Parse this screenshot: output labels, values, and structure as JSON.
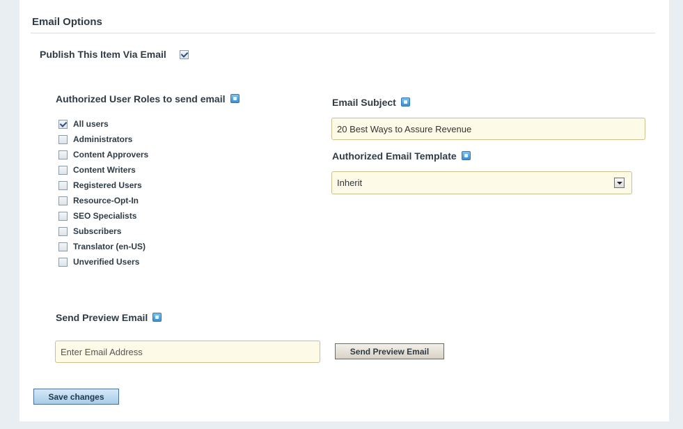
{
  "section": {
    "title": "Email Options"
  },
  "publish": {
    "label": "Publish This Item Via Email",
    "checked": true
  },
  "roles": {
    "heading": "Authorized User Roles to send email",
    "items": [
      {
        "label": "All users",
        "checked": true
      },
      {
        "label": "Administrators",
        "checked": false
      },
      {
        "label": "Content Approvers",
        "checked": false
      },
      {
        "label": "Content Writers",
        "checked": false
      },
      {
        "label": "Registered Users",
        "checked": false
      },
      {
        "label": "Resource-Opt-In",
        "checked": false
      },
      {
        "label": "SEO Specialists",
        "checked": false
      },
      {
        "label": "Subscribers",
        "checked": false
      },
      {
        "label": "Translator (en-US)",
        "checked": false
      },
      {
        "label": "Unverified Users",
        "checked": false
      }
    ]
  },
  "subject": {
    "heading": "Email Subject",
    "value": "20 Best Ways to Assure Revenue"
  },
  "template": {
    "heading": "Authorized Email Template",
    "selected": "Inherit"
  },
  "preview": {
    "heading": "Send Preview Email",
    "placeholder": "Enter Email Address",
    "button_label": "Send Preview Email"
  },
  "actions": {
    "save_label": "Save changes"
  }
}
